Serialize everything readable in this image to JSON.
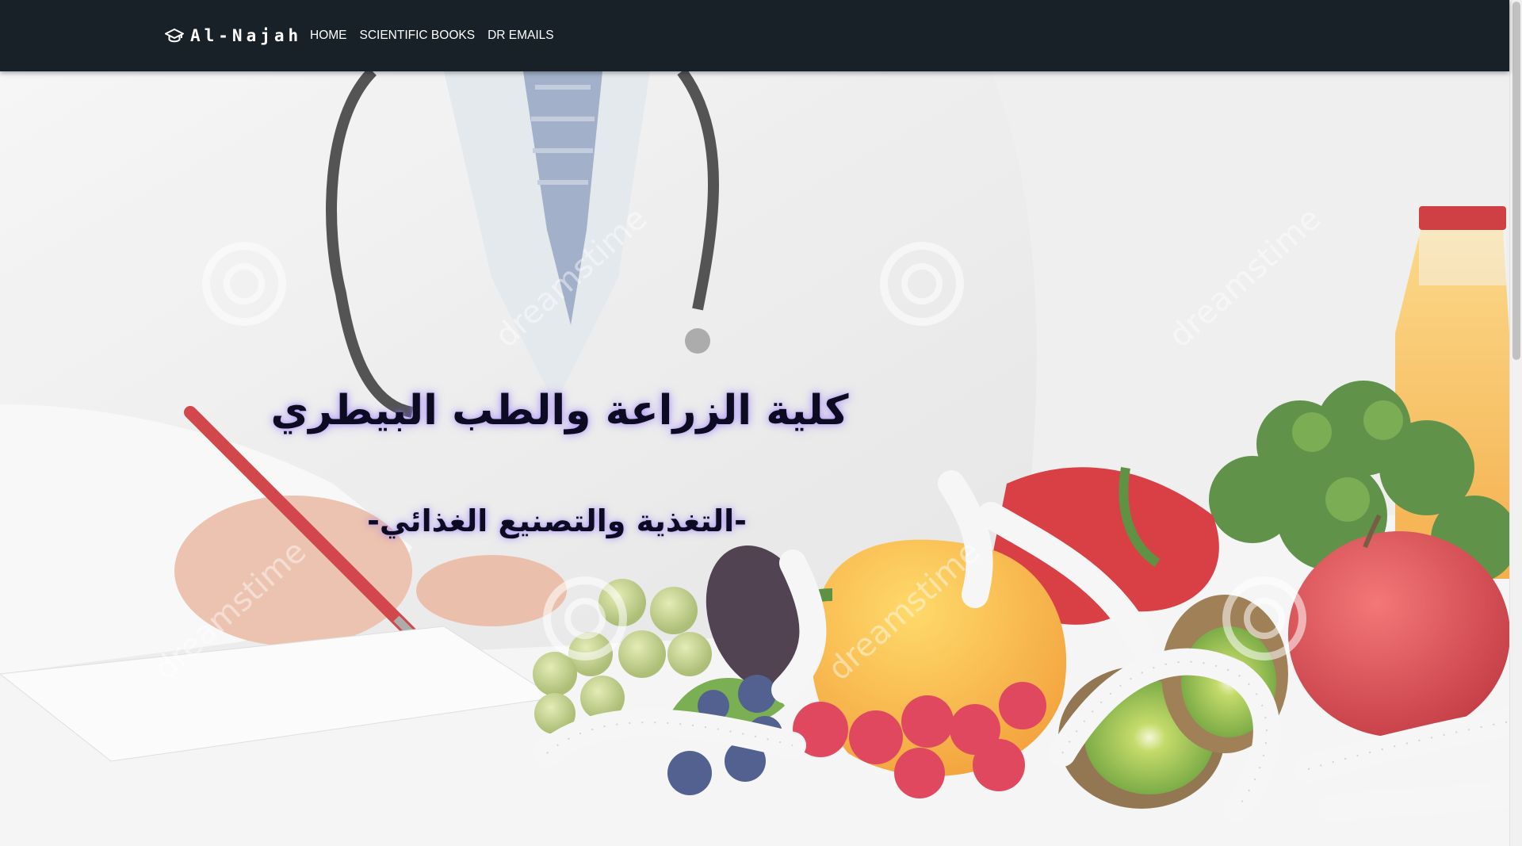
{
  "navbar": {
    "brand": {
      "icon": "graduation-cap-icon",
      "text": "Al-Najah"
    },
    "links": [
      {
        "label": "HOME"
      },
      {
        "label": "SCIENTIFIC BOOKS"
      },
      {
        "label": "DR EMAILS"
      }
    ],
    "background": "#172127"
  },
  "hero": {
    "title": "كلية الزراعة والطب البيطري",
    "subtitle": "-التغذية والتصنيع الغذائي-",
    "text_color": "#0d0b22",
    "glow_color": "#7850ff",
    "image": "doctor-with-vegetables-and-measuring-tape",
    "watermark": "dreamstime"
  }
}
